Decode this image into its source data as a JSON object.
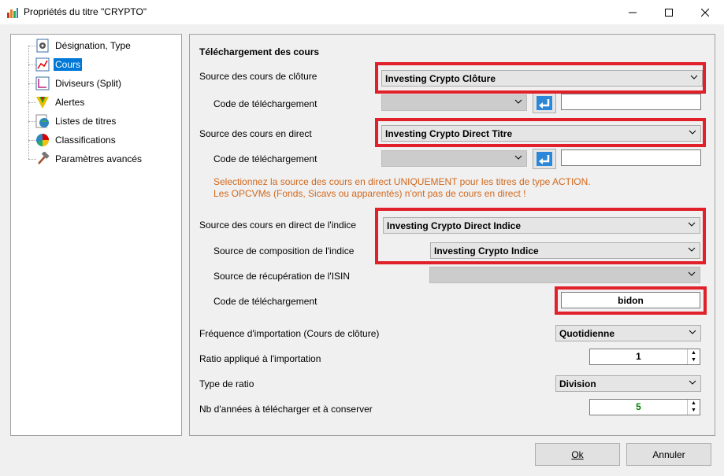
{
  "window": {
    "title": "Propriétés du titre \"CRYPTO\""
  },
  "tree": {
    "items": [
      {
        "label": "Désignation, Type",
        "icon": "gear-doc-icon"
      },
      {
        "label": "Cours",
        "icon": "line-chart-icon",
        "selected": true
      },
      {
        "label": "Diviseurs (Split)",
        "icon": "split-icon"
      },
      {
        "label": "Alertes",
        "icon": "alert-triangle-icon"
      },
      {
        "label": "Listes de titres",
        "icon": "globe-list-icon"
      },
      {
        "label": "Classifications",
        "icon": "pie-chart-icon"
      },
      {
        "label": "Paramètres avancés",
        "icon": "hammer-icon"
      }
    ]
  },
  "panel": {
    "heading": "Téléchargement des cours",
    "cloture": {
      "label": "Source des cours de clôture",
      "value": "Investing Crypto Clôture",
      "code_label": "Code de téléchargement",
      "code_select": "",
      "code_value": ""
    },
    "direct": {
      "label": "Source des cours en direct",
      "value": "Investing Crypto Direct Titre",
      "code_label": "Code de téléchargement",
      "code_select": "",
      "code_value": ""
    },
    "note_line1": "Selectionnez la source des cours en direct UNIQUEMENT pour les titres de type ACTION.",
    "note_line2": "Les OPCVMs (Fonds, Sicavs ou apparentés) n'ont pas de cours en direct !",
    "indice": {
      "label": "Source des cours en direct de l'indice",
      "value": "Investing Crypto Direct Indice",
      "composition_label": "Source de composition de l'indice",
      "composition_value": "Investing Crypto Indice",
      "isin_label": "Source de récupération de l'ISIN",
      "isin_value": "",
      "code_label": "Code de téléchargement",
      "code_value": "bidon"
    },
    "frequence": {
      "label": "Fréquence d'importation (Cours de clôture)",
      "value": "Quotidienne"
    },
    "ratio": {
      "label": "Ratio appliqué à l'importation",
      "value": "1"
    },
    "type_ratio": {
      "label": "Type de ratio",
      "value": "Division"
    },
    "nb_annees": {
      "label": "Nb d'années à télécharger et à conserver",
      "value": "5"
    }
  },
  "buttons": {
    "ok": "Ok",
    "cancel": "Annuler"
  },
  "colors": {
    "highlight": "#e0202a",
    "selection": "#0078d7",
    "note": "#d2691e",
    "years_value": "#008000"
  }
}
